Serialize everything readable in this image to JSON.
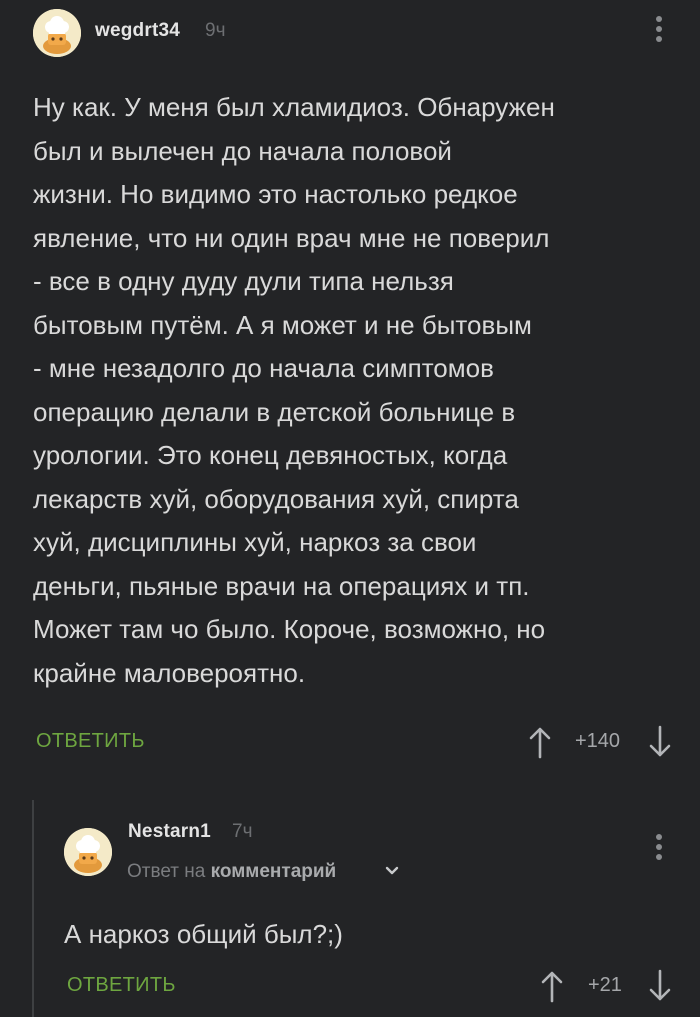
{
  "comments": [
    {
      "username": "wegdrt34",
      "time": "9ч",
      "text": "Ну как. У меня был хламидиоз. Обнаружен\nбыл и вылечен до начала половой\nжизни. Но видимо это настолько редкое\nявление, что ни один врач мне не поверил\n- все в одну дуду дули типа нельзя\nбытовым путём. А я может и не бытовым\n- мне незадолго до начала симптомов\nоперацию делали в детской больнице в\nурологии. Это конец девяностых, когда\nлекарств хуй, оборудования хуй, спирта\nхуй, дисциплины хуй, наркоз за свои\nденьги, пьяные врачи на операциях и тп.\nМожет там чо было. Короче, возможно, но\nкрайне маловероятно.",
      "reply_label": "ОТВЕТИТЬ",
      "score": "+140"
    },
    {
      "username": "Nestarn1",
      "time": "7ч",
      "reply_prefix": "Ответ на",
      "reply_target": "комментарий",
      "text": "А наркоз общий был?;)",
      "reply_label": "ОТВЕТИТЬ",
      "score": "+21"
    }
  ],
  "icons": {
    "avatar": "chef-hat-avatar-icon",
    "menu": "more-vertical-icon",
    "upvote": "arrow-up-icon",
    "downvote": "arrow-down-icon",
    "expand": "chevron-down-icon"
  },
  "colors": {
    "background": "#232426",
    "accent": "#6ea640",
    "text": "#d9d9d9",
    "muted": "#6d6f72"
  }
}
